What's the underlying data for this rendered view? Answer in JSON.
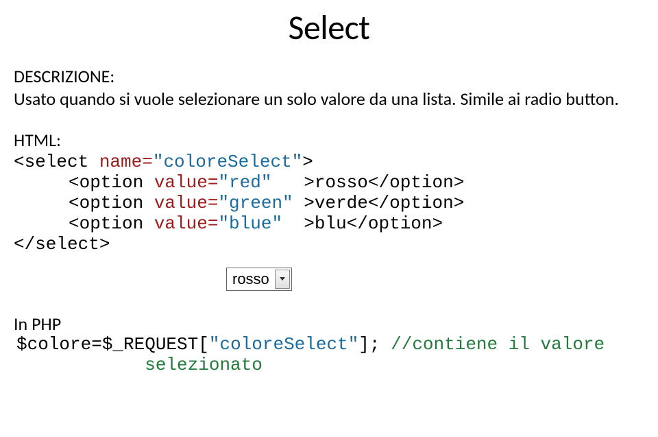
{
  "title": "Select",
  "desc_label": "DESCRIZIONE:",
  "desc_text": "Usato quando si vuole selezionare un solo valore da una lista. Simile ai radio button.",
  "html_label": "HTML:",
  "code": {
    "t1": "<select",
    "t2": " name=",
    "t3": "\"coloreSelect\"",
    "t4": ">",
    "opt_open": "<option",
    "val_attr": " value=",
    "r_val": "\"red\"   ",
    "r_txt": ">rosso</option>",
    "g_val": "\"green\" ",
    "g_txt": ">verde</option>",
    "b_val": "\"blue\"  ",
    "b_txt": ">blu</option>",
    "close": "</select>"
  },
  "visual_select_value": "rosso",
  "php_label": "In PHP",
  "php": {
    "p1": "$colore=$_REQUEST[",
    "p2": "\"coloreSelect\"",
    "p3": "]; ",
    "c1": "//contiene il valore",
    "c2": "            selezionato"
  }
}
